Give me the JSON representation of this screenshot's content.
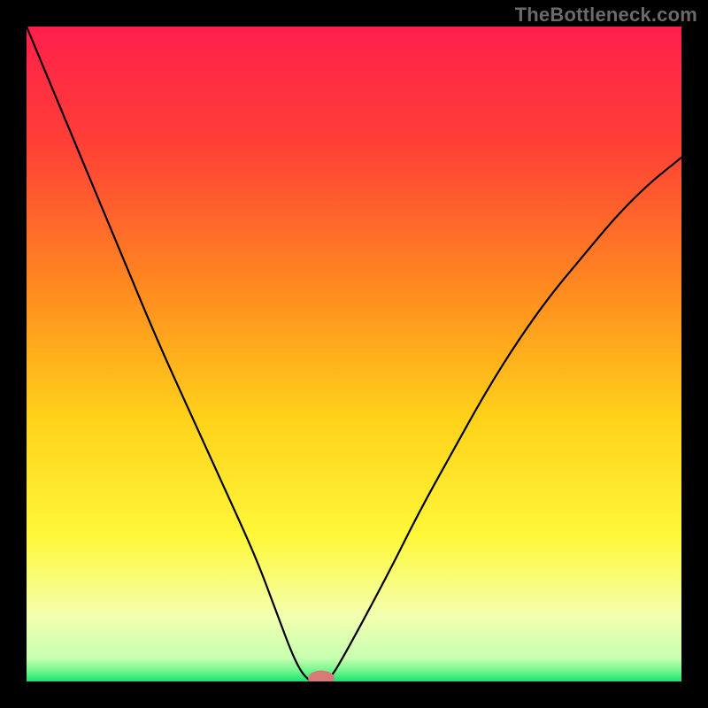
{
  "watermark": "TheBottleneck.com",
  "chart_data": {
    "type": "line",
    "title": "",
    "xlabel": "",
    "ylabel": "",
    "xlim": [
      0,
      100
    ],
    "ylim": [
      0,
      100
    ],
    "x": [
      0,
      5,
      10,
      15,
      20,
      25,
      30,
      35,
      38,
      41,
      43,
      45,
      46,
      48,
      55,
      60,
      65,
      70,
      75,
      80,
      85,
      90,
      95,
      100
    ],
    "values": [
      100,
      88,
      76,
      64,
      52,
      41,
      30,
      19,
      11,
      3,
      0,
      0,
      0,
      3,
      16,
      26,
      35,
      44,
      52,
      59,
      65,
      71,
      76,
      80
    ],
    "gradient_stops": [
      {
        "offset": 0.0,
        "color": "#ff1f4b"
      },
      {
        "offset": 0.18,
        "color": "#ff4037"
      },
      {
        "offset": 0.4,
        "color": "#ff8a1f"
      },
      {
        "offset": 0.6,
        "color": "#ffd21a"
      },
      {
        "offset": 0.78,
        "color": "#fff83a"
      },
      {
        "offset": 0.9,
        "color": "#f4ffb0"
      },
      {
        "offset": 0.965,
        "color": "#c6ffb0"
      },
      {
        "offset": 0.985,
        "color": "#6cf58a"
      },
      {
        "offset": 1.0,
        "color": "#19e36e"
      }
    ],
    "marker": {
      "x": 45,
      "y": 0,
      "rx": 2.0,
      "ry": 1.2,
      "color": "#d77a78"
    }
  }
}
